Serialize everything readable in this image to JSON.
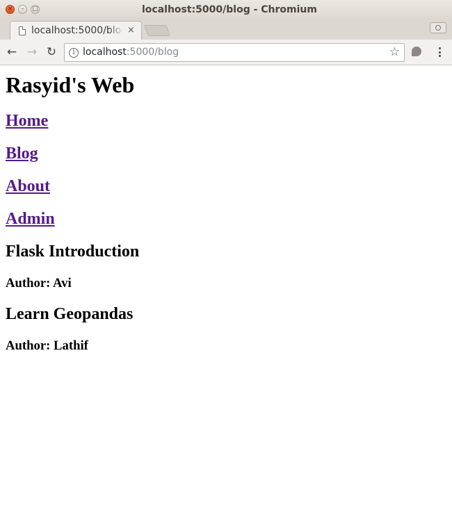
{
  "window": {
    "title": "localhost:5000/blog - Chromium",
    "buttons": {
      "close": "×",
      "minimize": "–",
      "maximize": "□"
    }
  },
  "tab": {
    "title": "localhost:5000/blog",
    "close": "×",
    "icon": "page-icon"
  },
  "toolbar": {
    "back": "←",
    "forward": "→",
    "reload": "↻",
    "url_host": "localhost",
    "url_rest": ":5000/blog",
    "info": "i",
    "star": "☆"
  },
  "page": {
    "site_title": "Rasyid's Web",
    "nav": [
      {
        "label": "Home"
      },
      {
        "label": "Blog"
      },
      {
        "label": "About"
      },
      {
        "label": "Admin"
      }
    ],
    "posts": [
      {
        "title": "Flask Introduction",
        "author": "Author: Avi"
      },
      {
        "title": "Learn Geopandas",
        "author": "Author: Lathif"
      }
    ]
  },
  "colors": {
    "visited_link": "#551a8b",
    "close_button": "#e0552b"
  }
}
